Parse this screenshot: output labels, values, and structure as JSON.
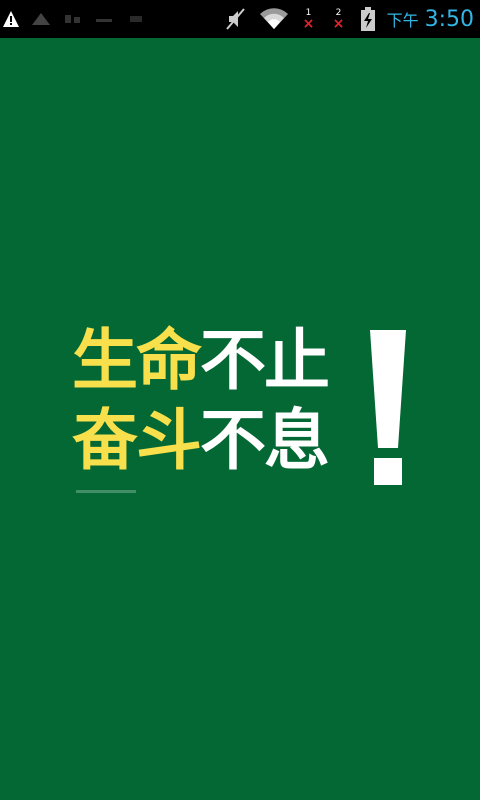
{
  "status_bar": {
    "icons": [
      "warning-icon",
      "notification-icon",
      "notification-icon",
      "notification-icon",
      "notification-icon",
      "mute-icon",
      "wifi-icon",
      "signal-sim1-icon",
      "signal-sim2-icon",
      "battery-charging-icon"
    ],
    "sim1_label": "1",
    "sim2_label": "2",
    "no_signal_mark": "×",
    "ampm": "下午",
    "time": "3:50",
    "clock_color": "#33b5e5"
  },
  "splash": {
    "background_color": "#036834",
    "slogan": {
      "line1_yellow": "生命",
      "line1_white": "不止",
      "line2_yellow": "奋斗",
      "line2_white": "不息",
      "exclamation": "!",
      "yellow_color": "#f7e04b",
      "white_color": "#ffffff"
    }
  }
}
